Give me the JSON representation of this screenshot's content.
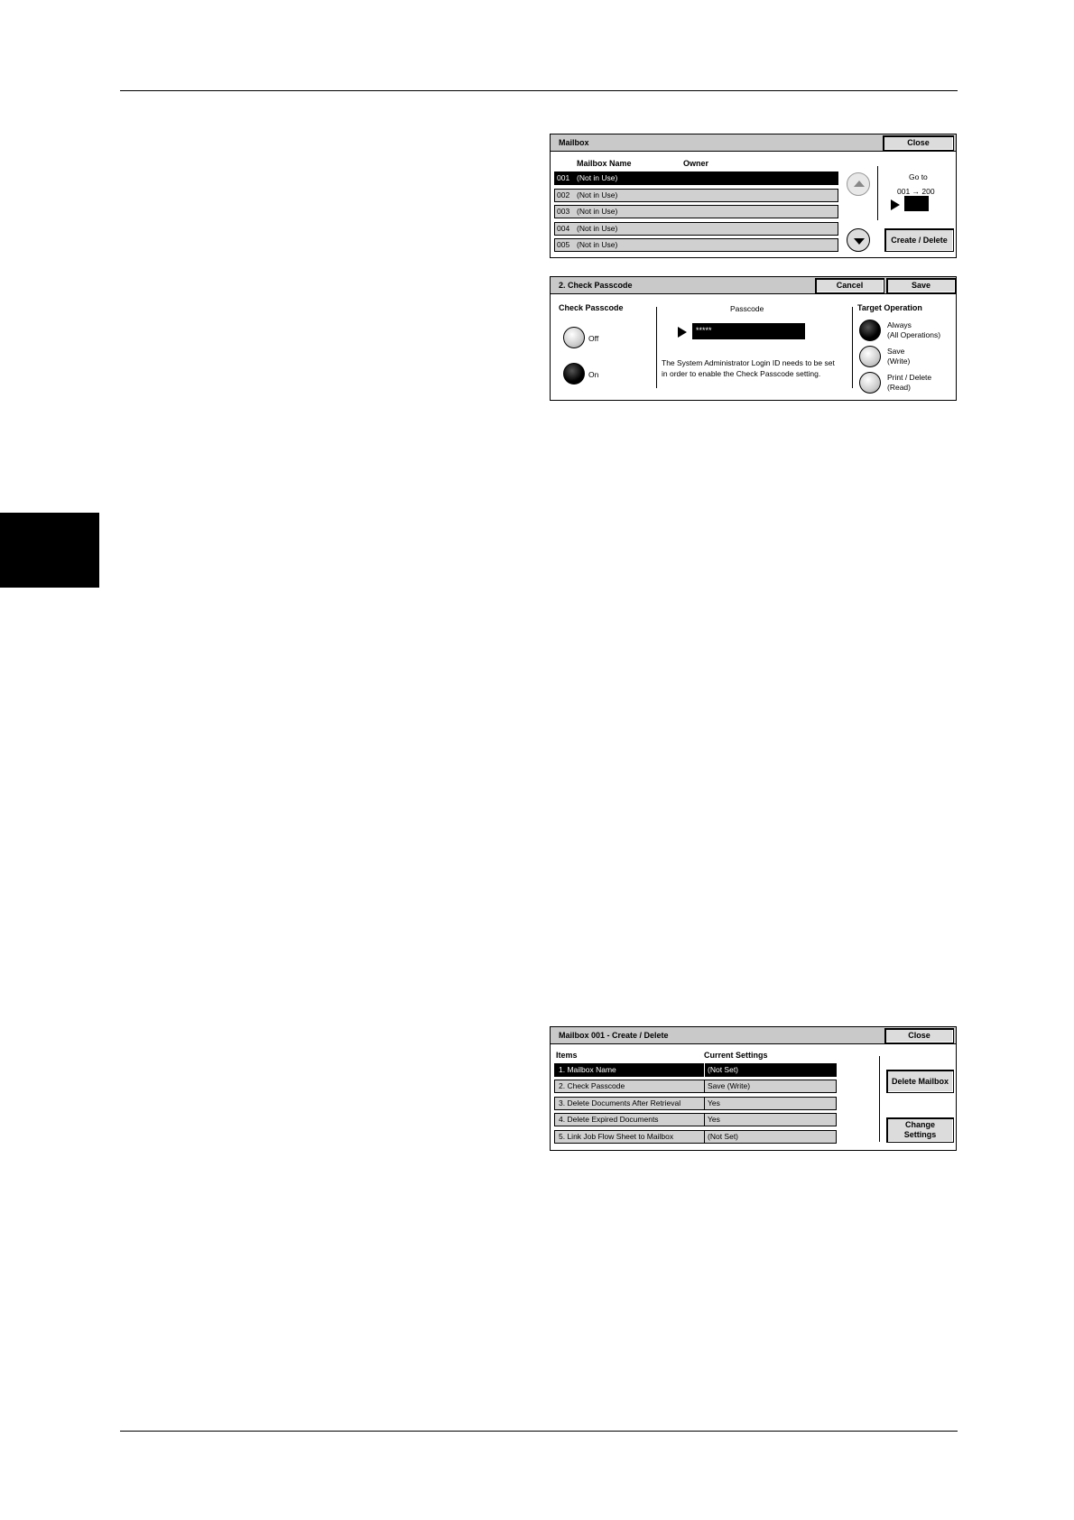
{
  "mailbox_panel": {
    "title": "Mailbox",
    "close_label": "Close",
    "col_name": "Mailbox Name",
    "col_owner": "Owner",
    "rows": [
      {
        "num": "001",
        "name": "(Not in Use)"
      },
      {
        "num": "002",
        "name": "(Not in Use)"
      },
      {
        "num": "003",
        "name": "(Not in Use)"
      },
      {
        "num": "004",
        "name": "(Not in Use)"
      },
      {
        "num": "005",
        "name": "(Not in Use)"
      }
    ],
    "goto_label": "Go to",
    "goto_range": "001 → 200",
    "create_delete_label": "Create / Delete"
  },
  "passcode_panel": {
    "title": "2. Check Passcode",
    "cancel_label": "Cancel",
    "save_label": "Save",
    "check_passcode_header": "Check Passcode",
    "off_label": "Off",
    "on_label": "On",
    "passcode_header": "Passcode",
    "passcode_value": "*****",
    "note_line1": "The System Administrator Login ID needs to be set",
    "note_line2": "in order to enable the Check Passcode setting.",
    "target_header": "Target Operation",
    "options": [
      {
        "line1": "Always",
        "line2": "(All Operations)"
      },
      {
        "line1": "Save",
        "line2": "(Write)"
      },
      {
        "line1": "Print / Delete",
        "line2": "(Read)"
      }
    ]
  },
  "create_panel": {
    "title": "Mailbox 001 - Create / Delete",
    "close_label": "Close",
    "col_items": "Items",
    "col_settings": "Current Settings",
    "rows": [
      {
        "label": "1. Mailbox Name",
        "value": "(Not Set)"
      },
      {
        "label": "2. Check Passcode",
        "value": "Save (Write)"
      },
      {
        "label": "3. Delete Documents After Retrieval",
        "value": "Yes"
      },
      {
        "label": "4. Delete Expired Documents",
        "value": "Yes"
      },
      {
        "label": "5. Link Job Flow Sheet to Mailbox",
        "value": "(Not Set)"
      }
    ],
    "delete_mailbox_label": "Delete Mailbox",
    "change_line1": "Change",
    "change_line2": "Settings"
  }
}
